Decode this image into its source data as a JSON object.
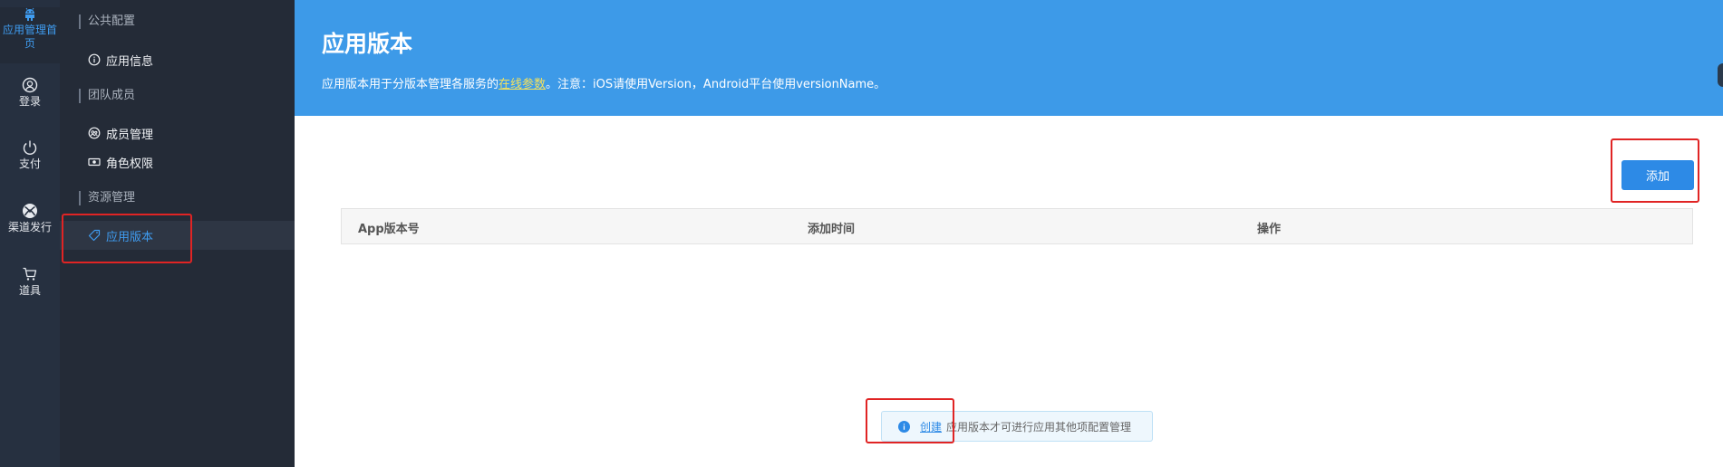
{
  "rail": {
    "items": [
      {
        "label": "应用管理首页",
        "icon": "android-icon",
        "active": true
      },
      {
        "label": "登录",
        "icon": "user-circle-icon"
      },
      {
        "label": "支付",
        "icon": "power-icon"
      },
      {
        "label": "渠道发行",
        "icon": "xbox-icon"
      },
      {
        "label": "道具",
        "icon": "cart-icon"
      }
    ]
  },
  "sidebar": {
    "groups": [
      {
        "title": "公共配置",
        "items": [
          {
            "label": "应用信息",
            "icon": "info-icon"
          }
        ]
      },
      {
        "title": "团队成员",
        "items": [
          {
            "label": "成员管理",
            "icon": "members-icon"
          },
          {
            "label": "角色权限",
            "icon": "money-icon"
          }
        ]
      },
      {
        "title": "资源管理",
        "items": [
          {
            "label": "应用版本",
            "icon": "tag-icon",
            "active": true
          }
        ]
      }
    ]
  },
  "header": {
    "title": "应用版本",
    "desc_prefix": "应用版本用于分版本管理各服务的",
    "desc_link": "在线参数",
    "desc_suffix": "。注意：iOS请使用Version，Android平台使用versionName。"
  },
  "toolbar": {
    "add_label": "添加"
  },
  "table": {
    "columns": [
      "App版本号",
      "添加时间",
      "操作"
    ],
    "rows": []
  },
  "notice": {
    "icon": "info-icon",
    "link": "创建",
    "text": "应用版本才可进行应用其他项配置管理"
  },
  "colors": {
    "banner": "#3d9ae8",
    "accent": "#2d8ae6",
    "rail_bg": "#263040",
    "sidebar_bg": "#242b37",
    "highlight": "#e02424"
  }
}
